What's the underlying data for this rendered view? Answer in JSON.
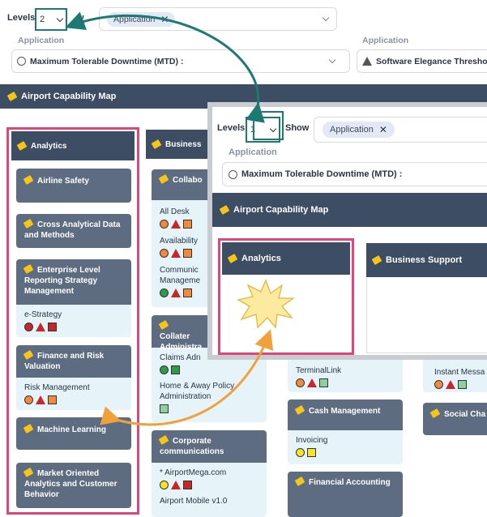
{
  "toolbar": {
    "levels_label": "Levels",
    "levels_value": "2",
    "show_label": "Show",
    "show_partial": "w",
    "chip_label": "Application",
    "chip_close": "✕"
  },
  "filters": {
    "left_label": "Application",
    "left_value": "Maximum Tolerable Downtime (MTD) :",
    "right_label": "Application",
    "right_value": "Software Elegance Threshol"
  },
  "map": {
    "title": "Airport Capability Map",
    "columns": [
      {
        "title": "Analytics",
        "items": [
          {
            "name": "Airline Safety",
            "apps": []
          },
          {
            "name": "Cross Analytical Data and Methods",
            "apps": []
          },
          {
            "name": "Enterprise Level Reporting Strategy Management",
            "apps": [
              {
                "name": "e-Strategy",
                "indicators": [
                  "red-circle",
                  "red-triangle",
                  "red-square"
                ]
              }
            ]
          },
          {
            "name": "Finance and Risk Valuation",
            "apps": [
              {
                "name": "Risk Management",
                "indicators": [
                  "orange-circle",
                  "red-triangle",
                  "orange-square"
                ]
              }
            ]
          },
          {
            "name": "Machine Learning",
            "apps": []
          },
          {
            "name": "Market Oriented Analytics and Customer Behavior",
            "apps": []
          }
        ]
      },
      {
        "title": "Business",
        "items": [
          {
            "name": "Collabo",
            "apps": [
              {
                "name": "All Desk",
                "indicators": [
                  "orange-circle",
                  "red-triangle",
                  "orange-square"
                ]
              },
              {
                "name": "Availability",
                "indicators": [
                  "orange-circle",
                  "red-triangle",
                  "orange-square"
                ]
              },
              {
                "name": "Communic Manageme",
                "indicators": [
                  "green-circle",
                  "red-triangle",
                  "orange-square"
                ]
              }
            ]
          },
          {
            "name": "Collater Administra",
            "apps": [
              {
                "name": "Claims Adn",
                "indicators": [
                  "green-circle",
                  "green-square"
                ]
              },
              {
                "name": "Home & Away Policy Administration",
                "indicators": [
                  "green-square"
                ]
              }
            ]
          },
          {
            "name": "Corporate communications",
            "apps": [
              {
                "name": "* AirportMega.com",
                "indicators": [
                  "yellow-circle",
                  "red-triangle",
                  "red-square"
                ]
              },
              {
                "name": "Airport Mobile v1.0",
                "indicators": []
              }
            ]
          }
        ]
      },
      {
        "title": "",
        "items": [
          {
            "name": "",
            "apps": [
              {
                "name": "TerminalLink",
                "indicators": [
                  "orange-circle",
                  "red-triangle",
                  "green-square"
                ]
              }
            ]
          },
          {
            "name": "Cash Management",
            "apps": [
              {
                "name": "Invoicing",
                "indicators": [
                  "yellow-circle",
                  "yellow-square"
                ]
              }
            ]
          },
          {
            "name": "Financial Accounting",
            "apps": []
          }
        ]
      },
      {
        "title": "",
        "items": [
          {
            "name": "",
            "apps": [
              {
                "name": "Instant Messa",
                "indicators": [
                  "orange-circle",
                  "red-triangle",
                  "green-square"
                ]
              }
            ]
          },
          {
            "name": "Social Cha",
            "apps": []
          }
        ]
      }
    ]
  },
  "zoom": {
    "levels_label": "Levels",
    "levels_value": "1",
    "show_label": "Show",
    "chip_label": "Application",
    "chip_close": "✕",
    "filter_label": "Application",
    "filter_value": "Maximum Tolerable Downtime (MTD) :",
    "map_title": "Airport Capability Map",
    "col1": "Analytics",
    "col2": "Business Support"
  },
  "colors": {
    "banner": "#3d4d63",
    "card_header": "#5e6c82",
    "card_body": "#e6f3f8",
    "highlight": "#e0457b",
    "teal": "#1c7a72",
    "red": "#c62828",
    "orange": "#f08a3c",
    "green": "#2e9b4a",
    "yellow": "#f4e52a",
    "light_green": "#8fd19e"
  }
}
